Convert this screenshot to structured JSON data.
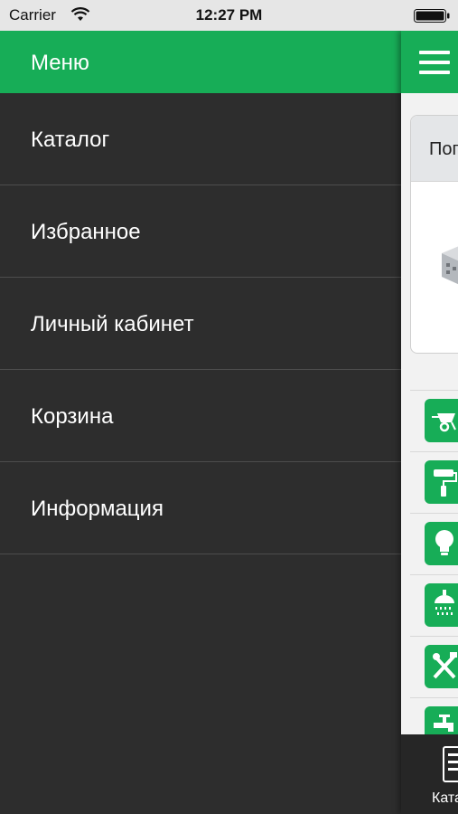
{
  "status_bar": {
    "carrier": "Carrier",
    "time": "12:27 PM"
  },
  "menu": {
    "title": "Меню",
    "items": [
      {
        "label": "Каталог"
      },
      {
        "label": "Избранное"
      },
      {
        "label": "Личный кабинет"
      },
      {
        "label": "Корзина"
      },
      {
        "label": "Информация"
      }
    ]
  },
  "main": {
    "promo_card_title": "Попу",
    "categories": [
      {
        "icon": "wheelbarrow-icon"
      },
      {
        "icon": "paint-roller-icon"
      },
      {
        "icon": "light-bulb-icon"
      },
      {
        "icon": "shower-icon"
      },
      {
        "icon": "tools-icon"
      },
      {
        "icon": "faucet-icon"
      }
    ],
    "tab_bar": {
      "catalog_label": "Каталог"
    }
  },
  "colors": {
    "accent_green": "#17ad57",
    "menu_background": "#2d2d2d",
    "tab_bar_background": "#262626"
  }
}
